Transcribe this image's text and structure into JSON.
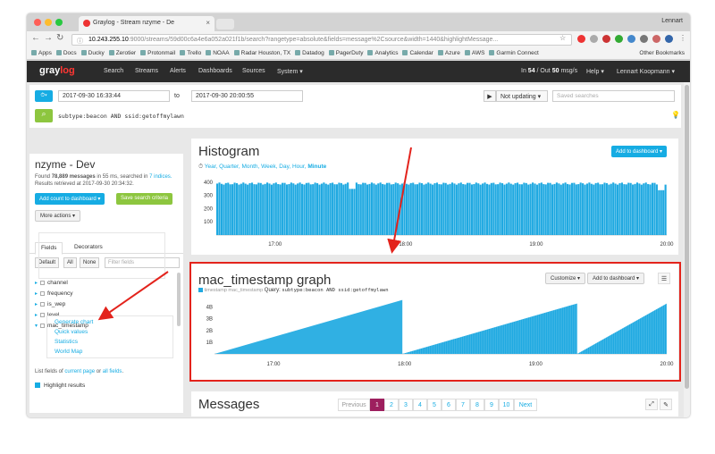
{
  "browser": {
    "tab_title": "Graylog - Stream nzyme - De",
    "user": "Lennart",
    "url_host": "10.243.255.10",
    "url_path": ":9000/streams/59d00c6a4e6a052a021f1b/search?rangetype=absolute&fields=message%2Csource&width=1440&highlightMessage...",
    "bookmarks": [
      "Apps",
      "Docs",
      "Ducky",
      "Zerotier",
      "Protonmail",
      "Trello",
      "NOAA",
      "Radar Houston, TX",
      "Datadog",
      "PagerDuty",
      "Analytics",
      "Calendar",
      "Azure",
      "AWS",
      "Garmin Connect"
    ],
    "other_bookmarks": "Other Bookmarks"
  },
  "nav": {
    "logo_a": "gray",
    "logo_b": "log",
    "items": [
      "Search",
      "Streams",
      "Alerts",
      "Dashboards",
      "Sources",
      "System ▾"
    ],
    "throughput_prefix": "In",
    "throughput_in": "54",
    "throughput_mid": "/ Out",
    "throughput_out": "50",
    "throughput_unit": "msg/s",
    "help": "Help ▾",
    "user": "Lennart Koopmann ▾"
  },
  "search": {
    "from": "2017-09-30 16:33:44",
    "to_label": "to",
    "to": "2017-09-30 20:00:55",
    "update": "Not updating ▾",
    "saved_placeholder": "Saved searches",
    "query": "subtype:beacon AND ssid:getoffmylawn"
  },
  "sidebar": {
    "title": "nzyme - Dev",
    "found_prefix": "Found",
    "found_count": "78,889 messages",
    "found_suffix": "in 55 ms, searched in",
    "indices": "7 indices.",
    "retrieved": "Results retrieved at 2017-09-30 20:34:32.",
    "add_count": "Add count to dashboard ▾",
    "save_criteria": "Save search criteria",
    "more_actions": "More actions ▾",
    "tabs": [
      "Fields",
      "Decorators"
    ],
    "filter_buttons": [
      "Default",
      "All",
      "None"
    ],
    "filter_placeholder": "Filter fields",
    "fields": [
      "channel",
      "frequency",
      "is_wep",
      "level",
      "mac_timestamp"
    ],
    "sub_actions": [
      "Generate chart",
      "Quick values",
      "Statistics",
      "World Map"
    ],
    "footer_prefix": "List fields of",
    "footer_current": "current page",
    "footer_or": "or",
    "footer_all": "all fields",
    "footer_end": ".",
    "highlight": "Highlight results"
  },
  "histogram": {
    "title": "Histogram",
    "resolutions": [
      "Year",
      "Quarter",
      "Month",
      "Week",
      "Day",
      "Hour",
      "Minute"
    ],
    "active_resolution": "Minute",
    "add_button": "Add to dashboard ▾"
  },
  "mac_graph": {
    "title": "mac_timestamp graph",
    "legend": "timestamp mac_timestamp",
    "query_label": "Query:",
    "query": "subtype:beacon AND ssid:getoffmylawn",
    "customize": "Customize ▾",
    "add_button": "Add to dashboard ▾",
    "menu_icon": "hamburger-icon"
  },
  "messages": {
    "title": "Messages",
    "previous": "Previous",
    "pages": [
      "1",
      "2",
      "3",
      "4",
      "5",
      "6",
      "7",
      "8",
      "9",
      "10"
    ],
    "next": "Next",
    "active_page": "1"
  },
  "colors": {
    "accent": "#16ace3",
    "green": "#8dc63f",
    "nav_bg": "#2b2b2b",
    "page_active": "#9d1f5e",
    "highlight": "#e3231c"
  },
  "chart_data": [
    {
      "type": "bar",
      "title": "Histogram",
      "x_ticks": [
        "17:00",
        "18:00",
        "19:00",
        "20:00"
      ],
      "x_range": [
        "16:33",
        "20:00"
      ],
      "y_ticks": [
        100,
        200,
        300,
        400
      ],
      "ylim": [
        0,
        420
      ],
      "typical_value": 390,
      "dips": [
        {
          "at": "17:35",
          "value": 350
        },
        {
          "at": "19:57",
          "value": 340
        }
      ],
      "series_color": "#1fa9e1",
      "grid": false
    },
    {
      "type": "area",
      "title": "mac_timestamp graph",
      "x_ticks": [
        "17:00",
        "18:00",
        "19:00",
        "20:00"
      ],
      "x_range": [
        "16:33",
        "20:00"
      ],
      "y_ticks": [
        "1B",
        "2B",
        "3B",
        "4B"
      ],
      "ylim": [
        0,
        4.8
      ],
      "y_unit": "B",
      "series": [
        {
          "name": "timestamp mac_timestamp",
          "segments": [
            {
              "start": "16:33",
              "end": "17:59",
              "from": 0,
              "to": 4.6
            },
            {
              "start": "17:59",
              "end": "19:19",
              "from": 0,
              "to": 4.3
            },
            {
              "start": "19:19",
              "end": "20:00",
              "from": 0,
              "to": 4.3
            }
          ]
        }
      ],
      "series_color": "#1fa9e1",
      "grid": false
    }
  ]
}
